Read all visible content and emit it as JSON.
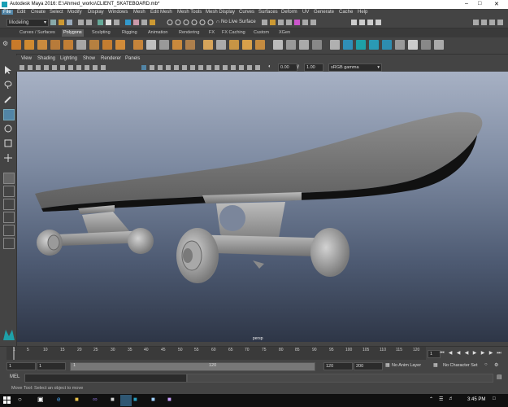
{
  "window": {
    "title": "Autodesk Maya 2016: E:\\Ahmed_works\\CLIENT_SKATEBOARD.mb*"
  },
  "menubar": [
    "File",
    "Edit",
    "Create",
    "Select",
    "Modify",
    "Display",
    "Windows",
    "Mesh",
    "Edit Mesh",
    "Mesh Tools",
    "Mesh Display",
    "Curves",
    "Surfaces",
    "Deform",
    "UV",
    "Generate",
    "Cache",
    "Help"
  ],
  "statusline": {
    "mode": "Modeling",
    "live_surface": "No Live Surface"
  },
  "shelf_tabs": [
    "Curves / Surfaces",
    "Polygons",
    "Sculpting",
    "Rigging",
    "Animation",
    "Rendering",
    "FX",
    "FX Caching",
    "Custom",
    "XGen"
  ],
  "shelf_active_tab": "Polygons",
  "panel_menu": [
    "View",
    "Shading",
    "Lighting",
    "Show",
    "Renderer",
    "Panels"
  ],
  "panel_toolbar": {
    "value1": "0.00",
    "value2": "1.00",
    "color_space": "sRGB gamma"
  },
  "viewport": {
    "camera_label": "persp"
  },
  "timeslider": {
    "ticks": [
      "1",
      "5",
      "10",
      "15",
      "20",
      "25",
      "30",
      "35",
      "40",
      "45",
      "50",
      "55",
      "60",
      "65",
      "70",
      "75",
      "80",
      "85",
      "90",
      "95",
      "100",
      "105",
      "110",
      "115",
      "120"
    ],
    "current_frame": "1"
  },
  "range": {
    "start": "1",
    "inner_start": "1",
    "slider_start": "1",
    "slider_end": "120",
    "inner_end": "120",
    "end": "200",
    "anim_layer": "No Anim Layer",
    "character_set": "No Character Set"
  },
  "command_line": {
    "label": "MEL"
  },
  "help_line": {
    "text": "Move Tool: Select an object to move"
  },
  "taskbar": {
    "time": "3:45 PM",
    "search_placeholder": ""
  }
}
